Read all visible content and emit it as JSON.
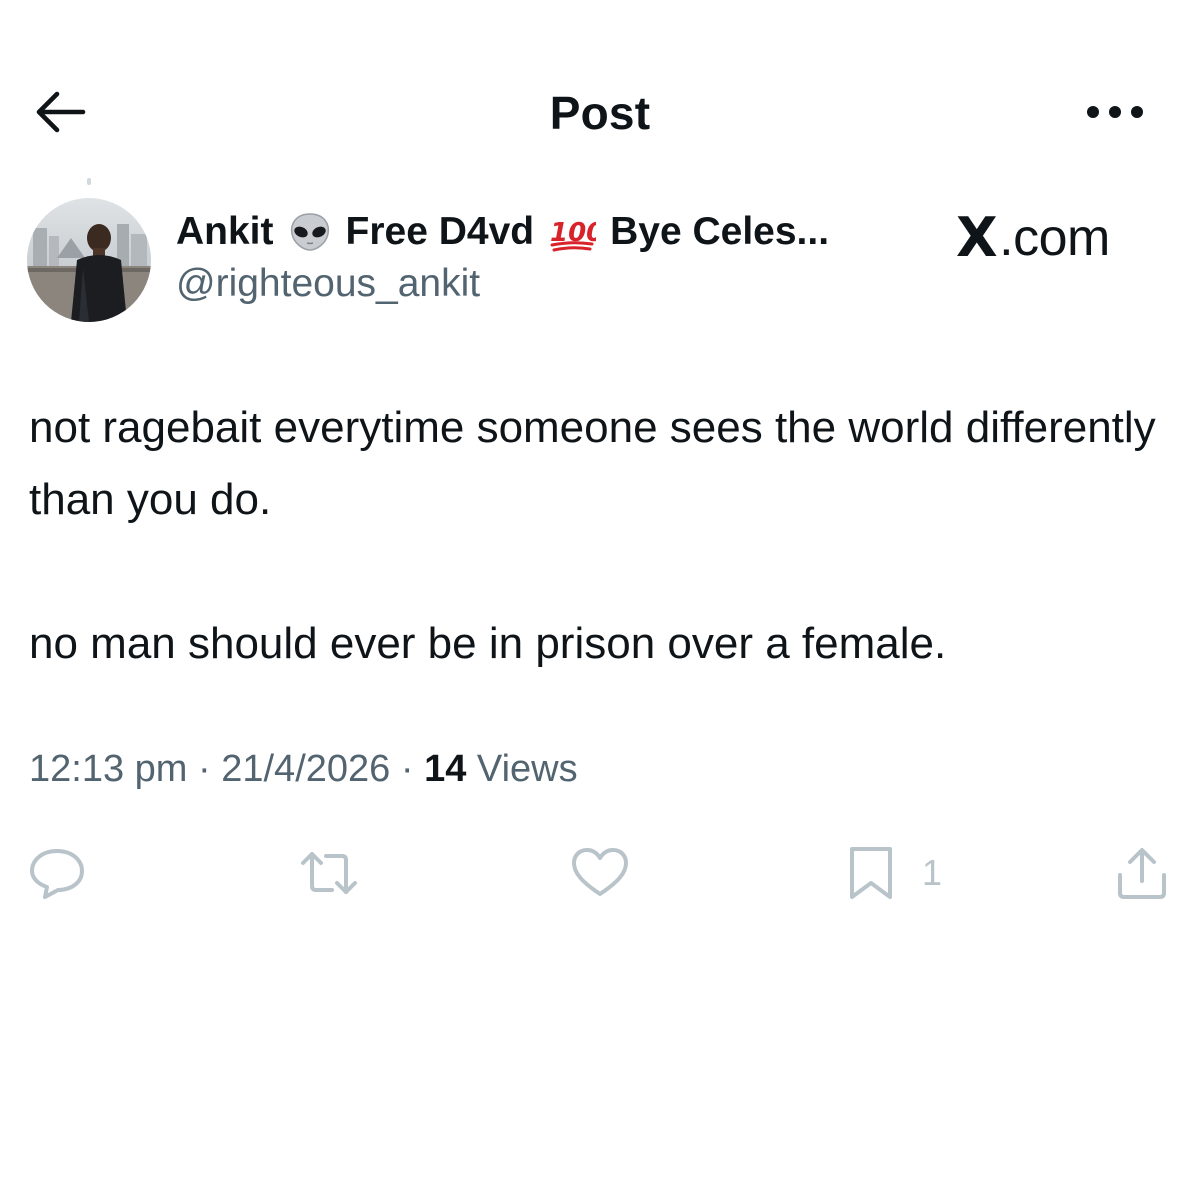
{
  "header": {
    "title": "Post",
    "back_icon": "arrow-left-icon",
    "more_icon": "more-horizontal-icon"
  },
  "author": {
    "display_name_parts": [
      "Ankit",
      "Free D4vd",
      "Bye Celes..."
    ],
    "emoji_1": "alien-emoji",
    "emoji_2": "hundred-points-emoji",
    "handle": "@righteous_ankit"
  },
  "watermark": {
    "text": ".com",
    "logo": "X"
  },
  "post": {
    "paragraph_1": "not ragebait everytime someone sees the world differently than you do.",
    "paragraph_2": "no man should ever be in prison over a female."
  },
  "meta": {
    "time": "12:13 pm",
    "separator": "·",
    "date": "21/4/2026",
    "views_count": "14",
    "views_label": "Views"
  },
  "actions": {
    "reply_count": "",
    "repost_count": "",
    "like_count": "",
    "bookmark_count": "1",
    "icon_color": "#b8c3ca"
  },
  "colors": {
    "text_primary": "#0f1419",
    "text_secondary": "#536471",
    "background": "#ffffff"
  }
}
